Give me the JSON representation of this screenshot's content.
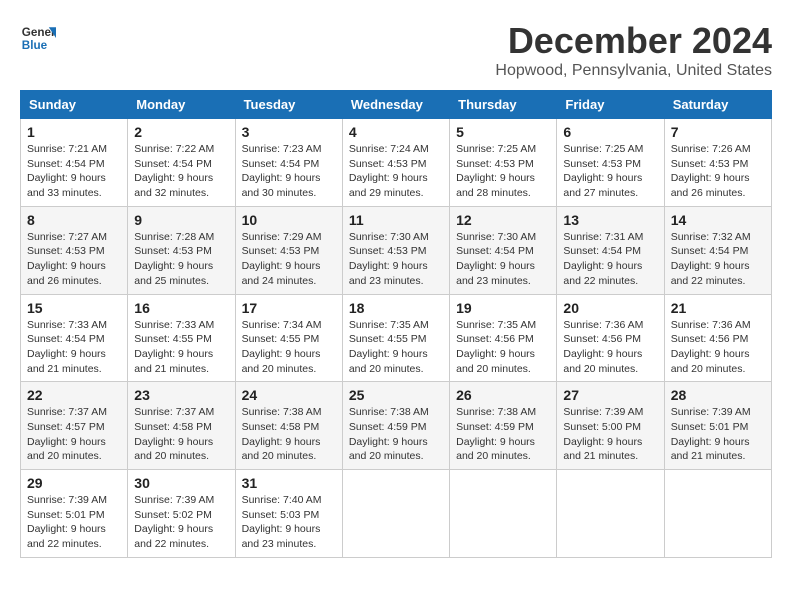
{
  "header": {
    "logo_line1": "General",
    "logo_line2": "Blue",
    "month_title": "December 2024",
    "location": "Hopwood, Pennsylvania, United States"
  },
  "columns": [
    "Sunday",
    "Monday",
    "Tuesday",
    "Wednesday",
    "Thursday",
    "Friday",
    "Saturday"
  ],
  "weeks": [
    [
      {
        "day": "1",
        "sunrise": "Sunrise: 7:21 AM",
        "sunset": "Sunset: 4:54 PM",
        "daylight": "Daylight: 9 hours and 33 minutes."
      },
      {
        "day": "2",
        "sunrise": "Sunrise: 7:22 AM",
        "sunset": "Sunset: 4:54 PM",
        "daylight": "Daylight: 9 hours and 32 minutes."
      },
      {
        "day": "3",
        "sunrise": "Sunrise: 7:23 AM",
        "sunset": "Sunset: 4:54 PM",
        "daylight": "Daylight: 9 hours and 30 minutes."
      },
      {
        "day": "4",
        "sunrise": "Sunrise: 7:24 AM",
        "sunset": "Sunset: 4:53 PM",
        "daylight": "Daylight: 9 hours and 29 minutes."
      },
      {
        "day": "5",
        "sunrise": "Sunrise: 7:25 AM",
        "sunset": "Sunset: 4:53 PM",
        "daylight": "Daylight: 9 hours and 28 minutes."
      },
      {
        "day": "6",
        "sunrise": "Sunrise: 7:25 AM",
        "sunset": "Sunset: 4:53 PM",
        "daylight": "Daylight: 9 hours and 27 minutes."
      },
      {
        "day": "7",
        "sunrise": "Sunrise: 7:26 AM",
        "sunset": "Sunset: 4:53 PM",
        "daylight": "Daylight: 9 hours and 26 minutes."
      }
    ],
    [
      {
        "day": "8",
        "sunrise": "Sunrise: 7:27 AM",
        "sunset": "Sunset: 4:53 PM",
        "daylight": "Daylight: 9 hours and 26 minutes."
      },
      {
        "day": "9",
        "sunrise": "Sunrise: 7:28 AM",
        "sunset": "Sunset: 4:53 PM",
        "daylight": "Daylight: 9 hours and 25 minutes."
      },
      {
        "day": "10",
        "sunrise": "Sunrise: 7:29 AM",
        "sunset": "Sunset: 4:53 PM",
        "daylight": "Daylight: 9 hours and 24 minutes."
      },
      {
        "day": "11",
        "sunrise": "Sunrise: 7:30 AM",
        "sunset": "Sunset: 4:53 PM",
        "daylight": "Daylight: 9 hours and 23 minutes."
      },
      {
        "day": "12",
        "sunrise": "Sunrise: 7:30 AM",
        "sunset": "Sunset: 4:54 PM",
        "daylight": "Daylight: 9 hours and 23 minutes."
      },
      {
        "day": "13",
        "sunrise": "Sunrise: 7:31 AM",
        "sunset": "Sunset: 4:54 PM",
        "daylight": "Daylight: 9 hours and 22 minutes."
      },
      {
        "day": "14",
        "sunrise": "Sunrise: 7:32 AM",
        "sunset": "Sunset: 4:54 PM",
        "daylight": "Daylight: 9 hours and 22 minutes."
      }
    ],
    [
      {
        "day": "15",
        "sunrise": "Sunrise: 7:33 AM",
        "sunset": "Sunset: 4:54 PM",
        "daylight": "Daylight: 9 hours and 21 minutes."
      },
      {
        "day": "16",
        "sunrise": "Sunrise: 7:33 AM",
        "sunset": "Sunset: 4:55 PM",
        "daylight": "Daylight: 9 hours and 21 minutes."
      },
      {
        "day": "17",
        "sunrise": "Sunrise: 7:34 AM",
        "sunset": "Sunset: 4:55 PM",
        "daylight": "Daylight: 9 hours and 20 minutes."
      },
      {
        "day": "18",
        "sunrise": "Sunrise: 7:35 AM",
        "sunset": "Sunset: 4:55 PM",
        "daylight": "Daylight: 9 hours and 20 minutes."
      },
      {
        "day": "19",
        "sunrise": "Sunrise: 7:35 AM",
        "sunset": "Sunset: 4:56 PM",
        "daylight": "Daylight: 9 hours and 20 minutes."
      },
      {
        "day": "20",
        "sunrise": "Sunrise: 7:36 AM",
        "sunset": "Sunset: 4:56 PM",
        "daylight": "Daylight: 9 hours and 20 minutes."
      },
      {
        "day": "21",
        "sunrise": "Sunrise: 7:36 AM",
        "sunset": "Sunset: 4:56 PM",
        "daylight": "Daylight: 9 hours and 20 minutes."
      }
    ],
    [
      {
        "day": "22",
        "sunrise": "Sunrise: 7:37 AM",
        "sunset": "Sunset: 4:57 PM",
        "daylight": "Daylight: 9 hours and 20 minutes."
      },
      {
        "day": "23",
        "sunrise": "Sunrise: 7:37 AM",
        "sunset": "Sunset: 4:58 PM",
        "daylight": "Daylight: 9 hours and 20 minutes."
      },
      {
        "day": "24",
        "sunrise": "Sunrise: 7:38 AM",
        "sunset": "Sunset: 4:58 PM",
        "daylight": "Daylight: 9 hours and 20 minutes."
      },
      {
        "day": "25",
        "sunrise": "Sunrise: 7:38 AM",
        "sunset": "Sunset: 4:59 PM",
        "daylight": "Daylight: 9 hours and 20 minutes."
      },
      {
        "day": "26",
        "sunrise": "Sunrise: 7:38 AM",
        "sunset": "Sunset: 4:59 PM",
        "daylight": "Daylight: 9 hours and 20 minutes."
      },
      {
        "day": "27",
        "sunrise": "Sunrise: 7:39 AM",
        "sunset": "Sunset: 5:00 PM",
        "daylight": "Daylight: 9 hours and 21 minutes."
      },
      {
        "day": "28",
        "sunrise": "Sunrise: 7:39 AM",
        "sunset": "Sunset: 5:01 PM",
        "daylight": "Daylight: 9 hours and 21 minutes."
      }
    ],
    [
      {
        "day": "29",
        "sunrise": "Sunrise: 7:39 AM",
        "sunset": "Sunset: 5:01 PM",
        "daylight": "Daylight: 9 hours and 22 minutes."
      },
      {
        "day": "30",
        "sunrise": "Sunrise: 7:39 AM",
        "sunset": "Sunset: 5:02 PM",
        "daylight": "Daylight: 9 hours and 22 minutes."
      },
      {
        "day": "31",
        "sunrise": "Sunrise: 7:40 AM",
        "sunset": "Sunset: 5:03 PM",
        "daylight": "Daylight: 9 hours and 23 minutes."
      },
      null,
      null,
      null,
      null
    ]
  ]
}
